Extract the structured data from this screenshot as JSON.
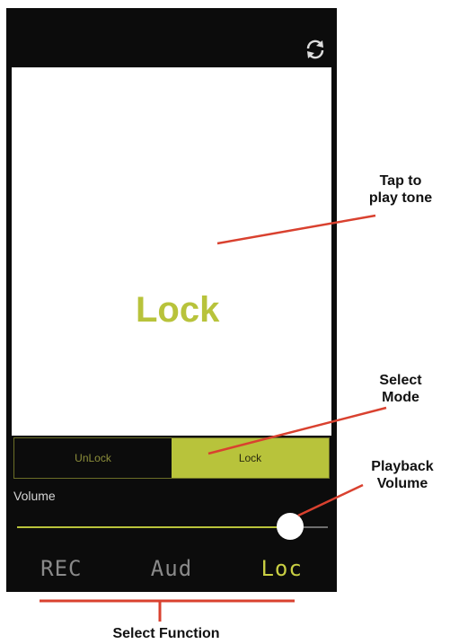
{
  "main": {
    "tone_label": "Lock"
  },
  "mode": {
    "options": [
      "UnLock",
      "Lock"
    ],
    "selected": "Lock"
  },
  "volume": {
    "label": "Volume",
    "level_percent": 88
  },
  "tabs": [
    {
      "label": "REC",
      "active": false
    },
    {
      "label": "Aud",
      "active": false
    },
    {
      "label": "Loc",
      "active": true
    }
  ],
  "callouts": {
    "tap": {
      "line1": "Tap to",
      "line2": "play tone"
    },
    "mode": {
      "line1": "Select",
      "line2": "Mode"
    },
    "volume": {
      "line1": "Playback",
      "line2": "Volume"
    },
    "function": "Select Function"
  },
  "icons": {
    "top_right": "refresh-icon"
  },
  "colors": {
    "accent": "#b8c33b",
    "callout_line": "#d9412f",
    "background": "#0c0c0c"
  }
}
